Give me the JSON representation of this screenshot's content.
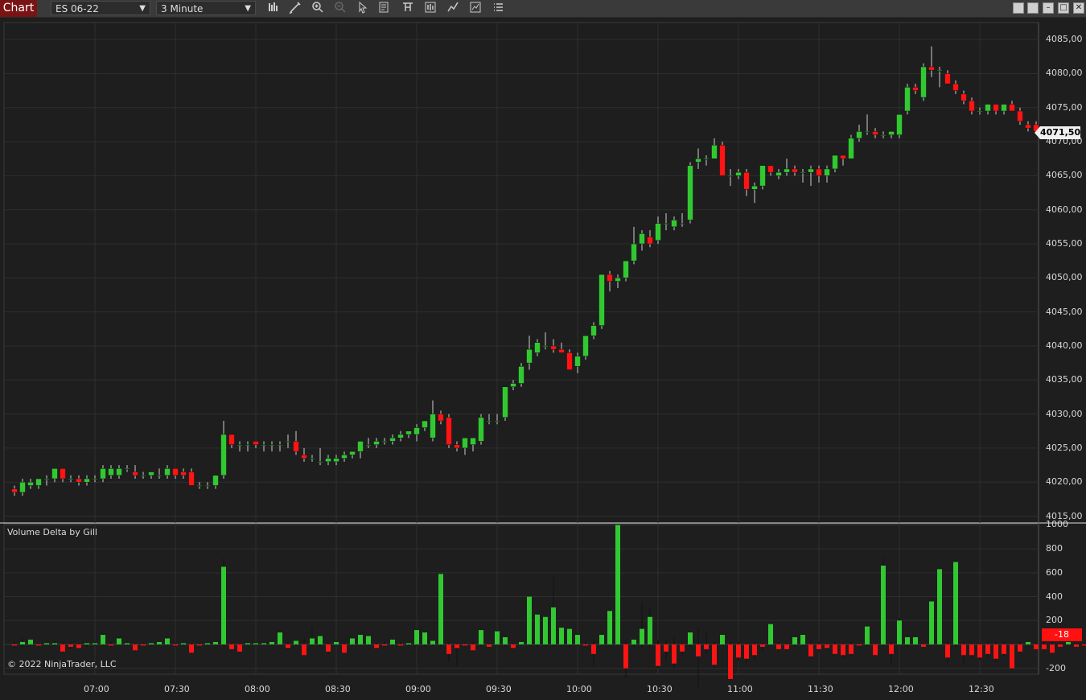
{
  "toolbar": {
    "chart_tab": "Chart",
    "instrument": "ES 06-22",
    "interval": "3 Minute",
    "icons": [
      "bars-type-icon",
      "draw-pencil-icon",
      "zoom-in-icon",
      "zoom-out-icon",
      "pointer-icon",
      "data-box-icon",
      "templates-icon",
      "chart-style-icon",
      "strategies-icon",
      "indicators-icon",
      "properties-icon"
    ]
  },
  "colors": {
    "up": "#32c832",
    "down": "#ff1414",
    "background": "#1e1e1e",
    "grid": "#2f2f2f"
  },
  "price_marker": "4071,50",
  "delta_marker": "-18",
  "indicator_title": "Volume Delta by Gill",
  "copyright": "© 2022 NinjaTrader, LLC",
  "chart_data": {
    "type": "candlestick",
    "price_ticks": [
      "4085,00",
      "4080,00",
      "4075,00",
      "4070,00",
      "4065,00",
      "4060,00",
      "4055,00",
      "4050,00",
      "4045,00",
      "4040,00",
      "4035,00",
      "4030,00",
      "4025,00",
      "4020,00",
      "4015,00"
    ],
    "price_tick_values": [
      4085,
      4080,
      4075,
      4070,
      4065,
      4060,
      4055,
      4050,
      4045,
      4040,
      4035,
      4030,
      4025,
      4020,
      4015
    ],
    "price_ylim": [
      4014.0,
      4087.5
    ],
    "delta_ticks": [
      "1000",
      "800",
      "600",
      "400",
      "200",
      "-200"
    ],
    "delta_tick_values": [
      1000,
      800,
      600,
      400,
      200,
      -200
    ],
    "delta_ylim": [
      -250,
      1010
    ],
    "time_ticks": [
      "07:00",
      "07:30",
      "08:00",
      "08:30",
      "09:00",
      "09:30",
      "10:00",
      "10:30",
      "11:00",
      "11:30",
      "12:00",
      "12:30"
    ],
    "candles": [
      [
        4019.0,
        4019.5,
        4018.0,
        4018.5
      ],
      [
        4018.5,
        4020.5,
        4018.0,
        4020.0
      ],
      [
        4019.5,
        4020.5,
        4019.0,
        4020.0
      ],
      [
        4019.5,
        4020.5,
        4019.0,
        4020.5
      ],
      [
        4020.5,
        4021.0,
        4019.5,
        4020.5
      ],
      [
        4020.5,
        4022.0,
        4020.0,
        4022.0
      ],
      [
        4022.0,
        4022.0,
        4020.0,
        4020.5
      ],
      [
        4020.5,
        4021.0,
        4020.0,
        4020.5
      ],
      [
        4020.5,
        4021.0,
        4019.5,
        4020.0
      ],
      [
        4020.0,
        4021.0,
        4019.5,
        4020.5
      ],
      [
        4020.5,
        4021.0,
        4020.0,
        4020.5
      ],
      [
        4020.5,
        4022.5,
        4020.0,
        4022.0
      ],
      [
        4021.0,
        4022.5,
        4020.5,
        4022.0
      ],
      [
        4021.0,
        4022.5,
        4020.5,
        4022.0
      ],
      [
        4022.0,
        4022.5,
        4021.5,
        4022.0
      ],
      [
        4021.5,
        4022.5,
        4020.5,
        4021.0
      ],
      [
        4021.0,
        4021.5,
        4020.5,
        4021.0
      ],
      [
        4021.0,
        4021.5,
        4020.5,
        4021.5
      ],
      [
        4021.0,
        4022.0,
        4020.5,
        4021.0
      ],
      [
        4021.0,
        4022.5,
        4020.5,
        4022.0
      ],
      [
        4022.0,
        4022.0,
        4020.5,
        4021.0
      ],
      [
        4021.5,
        4022.0,
        4020.5,
        4021.0
      ],
      [
        4021.5,
        4022.0,
        4019.5,
        4019.5
      ],
      [
        4019.5,
        4020.0,
        4019.0,
        4019.5
      ],
      [
        4019.5,
        4020.0,
        4019.0,
        4019.5
      ],
      [
        4019.5,
        4021.0,
        4019.0,
        4021.0
      ],
      [
        4021.0,
        4029.0,
        4020.5,
        4027.0
      ],
      [
        4027.0,
        4027.0,
        4025.0,
        4025.5
      ],
      [
        4025.5,
        4026.0,
        4024.5,
        4025.5
      ],
      [
        4025.5,
        4026.0,
        4024.5,
        4025.5
      ],
      [
        4026.0,
        4026.0,
        4025.0,
        4025.5
      ],
      [
        4025.5,
        4026.0,
        4024.5,
        4025.5
      ],
      [
        4025.5,
        4026.0,
        4024.5,
        4025.5
      ],
      [
        4025.5,
        4026.0,
        4024.5,
        4025.5
      ],
      [
        4026.0,
        4027.0,
        4025.0,
        4026.0
      ],
      [
        4026.0,
        4027.5,
        4024.0,
        4024.5
      ],
      [
        4024.0,
        4025.0,
        4023.0,
        4023.5
      ],
      [
        4023.5,
        4024.0,
        4023.0,
        4023.5
      ],
      [
        4023.0,
        4025.0,
        4022.5,
        4023.0
      ],
      [
        4023.0,
        4024.0,
        4022.5,
        4023.5
      ],
      [
        4023.0,
        4024.0,
        4022.5,
        4023.5
      ],
      [
        4023.5,
        4024.5,
        4023.0,
        4024.0
      ],
      [
        4024.0,
        4024.5,
        4023.5,
        4024.5
      ],
      [
        4024.5,
        4026.0,
        4023.5,
        4026.0
      ],
      [
        4025.5,
        4026.5,
        4025.0,
        4025.5
      ],
      [
        4025.5,
        4026.5,
        4025.0,
        4026.0
      ],
      [
        4026.0,
        4026.5,
        4025.5,
        4026.0
      ],
      [
        4026.0,
        4027.0,
        4025.5,
        4026.5
      ],
      [
        4026.5,
        4027.5,
        4026.0,
        4027.0
      ],
      [
        4027.0,
        4027.5,
        4026.5,
        4027.5
      ],
      [
        4027.0,
        4028.5,
        4026.0,
        4028.0
      ],
      [
        4028.0,
        4029.0,
        4027.5,
        4029.0
      ],
      [
        4026.5,
        4032.0,
        4026.0,
        4030.0
      ],
      [
        4030.0,
        4030.5,
        4028.5,
        4029.0
      ],
      [
        4029.5,
        4030.0,
        4025.0,
        4025.5
      ],
      [
        4025.5,
        4026.0,
        4024.5,
        4025.0
      ],
      [
        4025.0,
        4026.5,
        4024.0,
        4026.5
      ],
      [
        4025.5,
        4026.5,
        4024.5,
        4026.5
      ],
      [
        4026.0,
        4030.0,
        4025.5,
        4029.5
      ],
      [
        4029.0,
        4030.0,
        4028.5,
        4029.0
      ],
      [
        4029.0,
        4030.0,
        4028.5,
        4029.0
      ],
      [
        4029.5,
        4034.0,
        4029.0,
        4034.0
      ],
      [
        4034.0,
        4035.0,
        4033.5,
        4034.5
      ],
      [
        4034.5,
        4037.5,
        4034.0,
        4037.0
      ],
      [
        4037.5,
        4041.5,
        4036.5,
        4039.5
      ],
      [
        4039.0,
        4041.0,
        4038.5,
        4040.5
      ],
      [
        4040.0,
        4042.0,
        4039.5,
        4040.0
      ],
      [
        4040.0,
        4041.0,
        4039.0,
        4039.5
      ],
      [
        4039.5,
        4040.5,
        4039.0,
        4039.0
      ],
      [
        4039.0,
        4039.5,
        4036.5,
        4036.5
      ],
      [
        4037.0,
        4039.0,
        4036.0,
        4038.5
      ],
      [
        4038.5,
        4041.5,
        4038.0,
        4041.5
      ],
      [
        4041.5,
        4043.5,
        4041.0,
        4043.0
      ],
      [
        4043.0,
        4050.5,
        4042.5,
        4050.5
      ],
      [
        4050.5,
        4051.0,
        4048.0,
        4049.5
      ],
      [
        4049.5,
        4050.5,
        4048.5,
        4050.0
      ],
      [
        4050.0,
        4052.5,
        4049.5,
        4052.5
      ],
      [
        4052.5,
        4057.5,
        4052.0,
        4055.0
      ],
      [
        4055.0,
        4057.0,
        4054.0,
        4056.5
      ],
      [
        4056.0,
        4057.0,
        4054.5,
        4055.0
      ],
      [
        4055.5,
        4059.0,
        4055.0,
        4058.0
      ],
      [
        4058.0,
        4059.5,
        4057.0,
        4058.0
      ],
      [
        4057.5,
        4059.0,
        4057.0,
        4058.5
      ],
      [
        4058.0,
        4059.5,
        4057.5,
        4058.0
      ],
      [
        4058.5,
        4067.0,
        4058.0,
        4066.5
      ],
      [
        4067.0,
        4069.0,
        4066.0,
        4067.5
      ],
      [
        4067.5,
        4068.0,
        4066.5,
        4067.5
      ],
      [
        4067.5,
        4070.5,
        4067.5,
        4069.5
      ],
      [
        4069.5,
        4070.0,
        4065.0,
        4065.0
      ],
      [
        4065.0,
        4066.0,
        4063.5,
        4065.0
      ],
      [
        4065.0,
        4066.0,
        4064.5,
        4065.5
      ],
      [
        4065.5,
        4066.0,
        4062.0,
        4063.0
      ],
      [
        4063.0,
        4064.0,
        4061.0,
        4063.5
      ],
      [
        4063.5,
        4066.5,
        4063.0,
        4066.5
      ],
      [
        4066.5,
        4066.5,
        4065.0,
        4065.5
      ],
      [
        4065.0,
        4066.0,
        4064.5,
        4065.5
      ],
      [
        4065.5,
        4067.5,
        4065.0,
        4066.0
      ],
      [
        4066.0,
        4066.5,
        4065.0,
        4065.5
      ],
      [
        4065.5,
        4066.0,
        4064.0,
        4065.5
      ],
      [
        4065.5,
        4066.5,
        4063.5,
        4066.0
      ],
      [
        4066.0,
        4066.5,
        4064.0,
        4065.0
      ],
      [
        4065.0,
        4066.5,
        4064.0,
        4066.0
      ],
      [
        4066.0,
        4068.0,
        4065.5,
        4068.0
      ],
      [
        4068.0,
        4068.0,
        4066.5,
        4067.5
      ],
      [
        4067.5,
        4071.0,
        4067.5,
        4070.5
      ],
      [
        4070.5,
        4072.5,
        4070.0,
        4071.5
      ],
      [
        4071.5,
        4074.0,
        4071.0,
        4071.5
      ],
      [
        4071.5,
        4072.0,
        4070.5,
        4071.0
      ],
      [
        4071.0,
        4071.5,
        4070.5,
        4071.0
      ],
      [
        4071.0,
        4071.5,
        4070.5,
        4071.5
      ],
      [
        4071.0,
        4074.0,
        4070.5,
        4074.0
      ],
      [
        4074.5,
        4078.5,
        4074.0,
        4078.0
      ],
      [
        4078.0,
        4078.5,
        4077.0,
        4077.5
      ],
      [
        4076.5,
        4081.5,
        4076.0,
        4081.0
      ],
      [
        4081.0,
        4084.0,
        4079.5,
        4080.5
      ],
      [
        4080.5,
        4081.0,
        4078.0,
        4080.5
      ],
      [
        4080.0,
        4080.5,
        4078.5,
        4078.5
      ],
      [
        4078.5,
        4079.0,
        4077.0,
        4077.5
      ],
      [
        4077.0,
        4077.5,
        4075.5,
        4076.0
      ],
      [
        4076.0,
        4076.5,
        4074.0,
        4074.5
      ],
      [
        4074.5,
        4075.0,
        4074.0,
        4074.5
      ],
      [
        4074.5,
        4075.5,
        4074.0,
        4075.5
      ],
      [
        4075.5,
        4075.5,
        4074.0,
        4074.5
      ],
      [
        4074.5,
        4075.5,
        4074.0,
        4075.5
      ],
      [
        4075.5,
        4076.0,
        4074.5,
        4074.5
      ],
      [
        4074.5,
        4075.0,
        4072.5,
        4073.0
      ],
      [
        4072.5,
        4073.0,
        4071.5,
        4072.0
      ],
      [
        4072.5,
        4073.0,
        4071.5,
        4071.5
      ],
      [
        4071.5,
        4072.0,
        4071.0,
        4071.5
      ]
    ],
    "deltas": [
      [
        -10,
        20,
        -30
      ],
      [
        20,
        60,
        -20
      ],
      [
        40,
        40,
        -10
      ],
      [
        -10,
        10,
        -20
      ],
      [
        10,
        20,
        -10
      ],
      [
        10,
        30,
        -10
      ],
      [
        -60,
        20,
        -70
      ],
      [
        -20,
        20,
        -40
      ],
      [
        -30,
        10,
        -30
      ],
      [
        10,
        20,
        -20
      ],
      [
        10,
        20,
        -10
      ],
      [
        80,
        90,
        -10
      ],
      [
        -10,
        20,
        -20
      ],
      [
        50,
        60,
        -10
      ],
      [
        10,
        20,
        -10
      ],
      [
        -50,
        10,
        -60
      ],
      [
        -10,
        10,
        -20
      ],
      [
        10,
        20,
        -10
      ],
      [
        20,
        30,
        -10
      ],
      [
        50,
        60,
        -10
      ],
      [
        -10,
        10,
        -20
      ],
      [
        10,
        20,
        -10
      ],
      [
        -70,
        10,
        -80
      ],
      [
        -10,
        10,
        -20
      ],
      [
        10,
        20,
        -10
      ],
      [
        20,
        30,
        -10
      ],
      [
        650,
        720,
        -10
      ],
      [
        -40,
        20,
        -50
      ],
      [
        -60,
        10,
        -60
      ],
      [
        10,
        20,
        -10
      ],
      [
        10,
        20,
        -10
      ],
      [
        10,
        20,
        -10
      ],
      [
        20,
        30,
        -10
      ],
      [
        100,
        110,
        -10
      ],
      [
        -30,
        20,
        -50
      ],
      [
        30,
        40,
        -10
      ],
      [
        -90,
        50,
        -100
      ],
      [
        50,
        150,
        -10
      ],
      [
        70,
        80,
        -20
      ],
      [
        -60,
        10,
        -80
      ],
      [
        20,
        30,
        -10
      ],
      [
        -70,
        20,
        -80
      ],
      [
        50,
        60,
        -10
      ],
      [
        80,
        90,
        -10
      ],
      [
        70,
        80,
        -10
      ],
      [
        -30,
        20,
        -40
      ],
      [
        -10,
        20,
        -20
      ],
      [
        40,
        50,
        -10
      ],
      [
        -10,
        20,
        -20
      ],
      [
        10,
        20,
        -10
      ],
      [
        120,
        130,
        -10
      ],
      [
        100,
        110,
        -20
      ],
      [
        30,
        40,
        -10
      ],
      [
        590,
        600,
        -20
      ],
      [
        -80,
        20,
        -150
      ],
      [
        -30,
        10,
        -180
      ],
      [
        -10,
        10,
        -20
      ],
      [
        -50,
        20,
        -60
      ],
      [
        120,
        130,
        -20
      ],
      [
        -20,
        10,
        -30
      ],
      [
        110,
        120,
        -10
      ],
      [
        60,
        70,
        -20
      ],
      [
        -30,
        10,
        -40
      ],
      [
        20,
        30,
        -10
      ],
      [
        400,
        410,
        -10
      ],
      [
        250,
        260,
        -20
      ],
      [
        230,
        240,
        -20
      ],
      [
        310,
        570,
        -20
      ],
      [
        140,
        150,
        -10
      ],
      [
        130,
        140,
        -20
      ],
      [
        80,
        90,
        -10
      ],
      [
        -10,
        20,
        -20
      ],
      [
        -80,
        40,
        -180
      ],
      [
        80,
        100,
        -10
      ],
      [
        280,
        300,
        -10
      ],
      [
        1000,
        1000,
        -10
      ],
      [
        -200,
        30,
        -280
      ],
      [
        40,
        50,
        -20
      ],
      [
        130,
        350,
        -30
      ],
      [
        230,
        300,
        -20
      ],
      [
        -180,
        40,
        -200
      ],
      [
        -60,
        40,
        -130
      ],
      [
        -160,
        60,
        -200
      ],
      [
        -60,
        10,
        -100
      ],
      [
        100,
        110,
        -20
      ],
      [
        -100,
        140,
        -370
      ],
      [
        -40,
        100,
        -80
      ],
      [
        -170,
        20,
        -200
      ],
      [
        80,
        90,
        -10
      ],
      [
        -290,
        20,
        -300
      ],
      [
        -110,
        20,
        -140
      ],
      [
        -120,
        10,
        -160
      ],
      [
        -90,
        20,
        -130
      ],
      [
        -20,
        10,
        -60
      ],
      [
        170,
        180,
        -10
      ],
      [
        -40,
        20,
        -60
      ],
      [
        -40,
        10,
        -50
      ],
      [
        60,
        70,
        -20
      ],
      [
        80,
        90,
        -10
      ],
      [
        -100,
        40,
        -120
      ],
      [
        -40,
        20,
        -60
      ],
      [
        -30,
        10,
        -40
      ],
      [
        -80,
        20,
        -90
      ],
      [
        -90,
        10,
        -110
      ],
      [
        -80,
        20,
        -100
      ],
      [
        -10,
        10,
        -20
      ],
      [
        150,
        160,
        -10
      ],
      [
        -90,
        10,
        -100
      ],
      [
        660,
        720,
        -10
      ],
      [
        -80,
        20,
        -160
      ],
      [
        200,
        220,
        -10
      ],
      [
        60,
        80,
        -20
      ],
      [
        60,
        70,
        -10
      ],
      [
        -20,
        10,
        -30
      ],
      [
        360,
        380,
        -10
      ],
      [
        630,
        640,
        -10
      ],
      [
        -110,
        20,
        -160
      ],
      [
        690,
        710,
        -20
      ],
      [
        -90,
        20,
        -160
      ],
      [
        -90,
        10,
        -110
      ],
      [
        -110,
        10,
        -130
      ],
      [
        -80,
        20,
        -120
      ],
      [
        -120,
        20,
        -150
      ],
      [
        -80,
        20,
        -100
      ],
      [
        -200,
        10,
        -220
      ],
      [
        -60,
        20,
        -70
      ],
      [
        20,
        30,
        -10
      ],
      [
        -40,
        10,
        -50
      ],
      [
        -40,
        20,
        -60
      ],
      [
        -70,
        20,
        -80
      ],
      [
        -20,
        20,
        -30
      ],
      [
        20,
        30,
        -10
      ],
      [
        -20,
        10,
        -40
      ],
      [
        -10,
        20,
        -20
      ]
    ]
  }
}
